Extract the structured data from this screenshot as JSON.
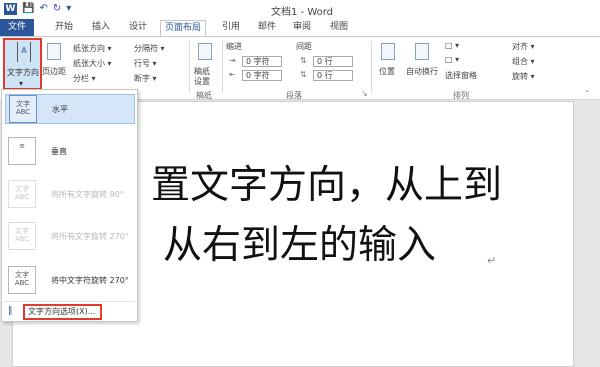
{
  "titlebar": {
    "word_icon": "W",
    "title": "文档1 - Word",
    "smiley": "☺"
  },
  "tabs": [
    {
      "label": "文件"
    },
    {
      "label": "开始"
    },
    {
      "label": "插入"
    },
    {
      "label": "设计"
    },
    {
      "label": "页面布局"
    },
    {
      "label": "引用"
    },
    {
      "label": "邮件"
    },
    {
      "label": "审阅"
    },
    {
      "label": "视图"
    }
  ],
  "ribbon": {
    "text_direction": {
      "label": "文字方向",
      "caret": "▾"
    },
    "margins": "页边距",
    "orientation": "纸张方向 ▾",
    "size": "纸张大小 ▾",
    "columns": "分栏 ▾",
    "breaks": "分隔符 ▾",
    "line_numbers": "行号 ▾",
    "hyphenation": "断字 ▾",
    "draft_paper": {
      "line1": "稿纸",
      "line2": "设置"
    },
    "draft_group": "稿纸",
    "indent": {
      "header": "缩进",
      "left": "0 字符",
      "right": "0 字符"
    },
    "spacing": {
      "header": "间距",
      "before": "0 行",
      "after": "0 行"
    },
    "paragraph_group": "段落",
    "position": "位置",
    "wrap_text": "自动换行",
    "selection_pane": "选择窗格",
    "align": "对齐 ▾",
    "group": "组合 ▾",
    "rotate": "旋转 ▾",
    "arrange_group": "排列"
  },
  "menu": {
    "items": [
      {
        "icon_text": "文字 ABC",
        "label": "水平",
        "enabled": true
      },
      {
        "icon_text": "",
        "label": "垂直",
        "enabled": true
      },
      {
        "icon_text": "文字 ABC",
        "label": "将所有文字旋转 90°",
        "enabled": false
      },
      {
        "icon_text": "文字 ABC",
        "label": "将所有文字旋转 270°",
        "enabled": false
      },
      {
        "icon_text": "文字 ABC",
        "label": "将中文字符旋转 270°",
        "enabled": true
      }
    ],
    "options": "文字方向选项(X)..."
  },
  "document": {
    "line1": "置文字方向，从上到",
    "line2": "从右到左的输入",
    "paragraph_mark": "↵"
  }
}
